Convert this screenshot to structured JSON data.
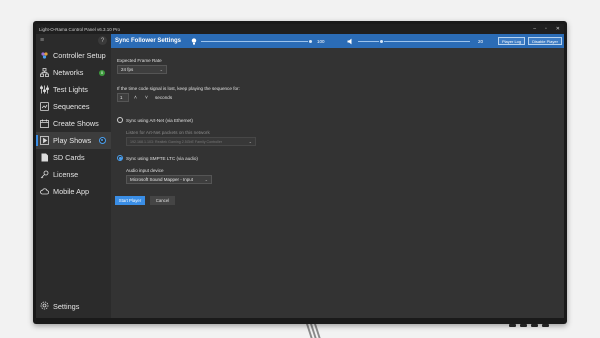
{
  "window": {
    "title": "Light-O-Rama Control Panel v6.3.10 Pro",
    "minimize": "–",
    "maximize": "▫",
    "close": "✕"
  },
  "sidebar": {
    "menu": "≡",
    "help": "?",
    "items": [
      {
        "label": "Controller Setup",
        "icon": "controller-icon"
      },
      {
        "label": "Networks",
        "icon": "network-icon",
        "badge": "0"
      },
      {
        "label": "Test Lights",
        "icon": "sliders-icon"
      },
      {
        "label": "Sequences",
        "icon": "sequence-icon"
      },
      {
        "label": "Create Shows",
        "icon": "calendar-icon"
      },
      {
        "label": "Play Shows",
        "icon": "play-icon",
        "active": true
      },
      {
        "label": "SD Cards",
        "icon": "sdcard-icon"
      },
      {
        "label": "License",
        "icon": "key-icon"
      },
      {
        "label": "Mobile App",
        "icon": "cloud-icon"
      }
    ],
    "settings_label": "Settings"
  },
  "header": {
    "title": "Sync Follower Settings",
    "brightness_value": "100",
    "brightness_level": 1.0,
    "volume_value": "20",
    "volume_level": 0.2,
    "player_log_label": "Player Log",
    "disable_player_label": "Disable Player"
  },
  "form": {
    "frame_rate_label": "Expected Frame Rate",
    "frame_rate_value": "24 fps",
    "signal_lost_label": "If the time code signal is lost, keep playing the sequence for:",
    "signal_lost_value": "1",
    "signal_lost_unit": "seconds",
    "artnet_label": "Sync using Art-Net (via Ethernet)",
    "artnet_network_label": "Listen for Art-Net packets on this network",
    "artnet_network_value": "192.168.1.103: Realtek Gaming 2.5GbE Family Controller",
    "smpte_label": "Sync using SMPTE LTC (via audio)",
    "audio_device_label": "Audio input device",
    "audio_device_value": "Microsoft Sound Mapper - Input",
    "start_label": "Start Player",
    "cancel_label": "Cancel"
  }
}
